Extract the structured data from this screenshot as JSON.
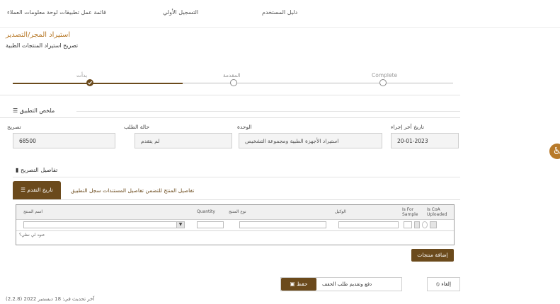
{
  "topnav": {
    "items": [
      "قائمة عمل تطبيقات لوحة معلومات العملاء",
      "التسجيل الأولي",
      "دليل المستخدم"
    ]
  },
  "page": {
    "title": "استيراد المجر/التصدير",
    "subtitle": "تصريح استيراد المنتجات الطبية"
  },
  "steps": [
    "بدأت",
    "المقدمة",
    "Complete"
  ],
  "summary": {
    "title": "ملخص التطبيق",
    "fields": [
      {
        "label": "تصريح",
        "value": "68500"
      },
      {
        "label": "حالة الطلب",
        "value": "لم يتقدم"
      },
      {
        "label": "الوحدة",
        "value": "استيراد الأجهزة الطبية ومجموعة التشخيص"
      },
      {
        "label": "تاريخ آخر إجراء",
        "value": "20-01-2023"
      }
    ]
  },
  "details": {
    "title": "تفاصيل التصريح",
    "tabs_active": "تاريخ التقدم",
    "tabs_rest": "تفاصيل المنتج للتضمن تفاصيل المستندات سجل التطبيق"
  },
  "grid": {
    "columns": [
      "اسم المنتج",
      "Quantity",
      "نوع المنتج",
      "الوكيل",
      "Is For Sample",
      "Is CoA Uploaded"
    ],
    "empty_text": "عنود لي نظي؟"
  },
  "buttons": {
    "add_product": "إضافة منتجات",
    "save": "حفظ",
    "submit": "دفع وتقديم طلب الحقف",
    "cancel": "إلغاء"
  },
  "footer": {
    "updated": "آخر تحديث في: 18 ديسمبر 2022 (2.2.8)"
  },
  "colors": {
    "accent": "#6b4a1c",
    "title": "#b87a2a"
  }
}
